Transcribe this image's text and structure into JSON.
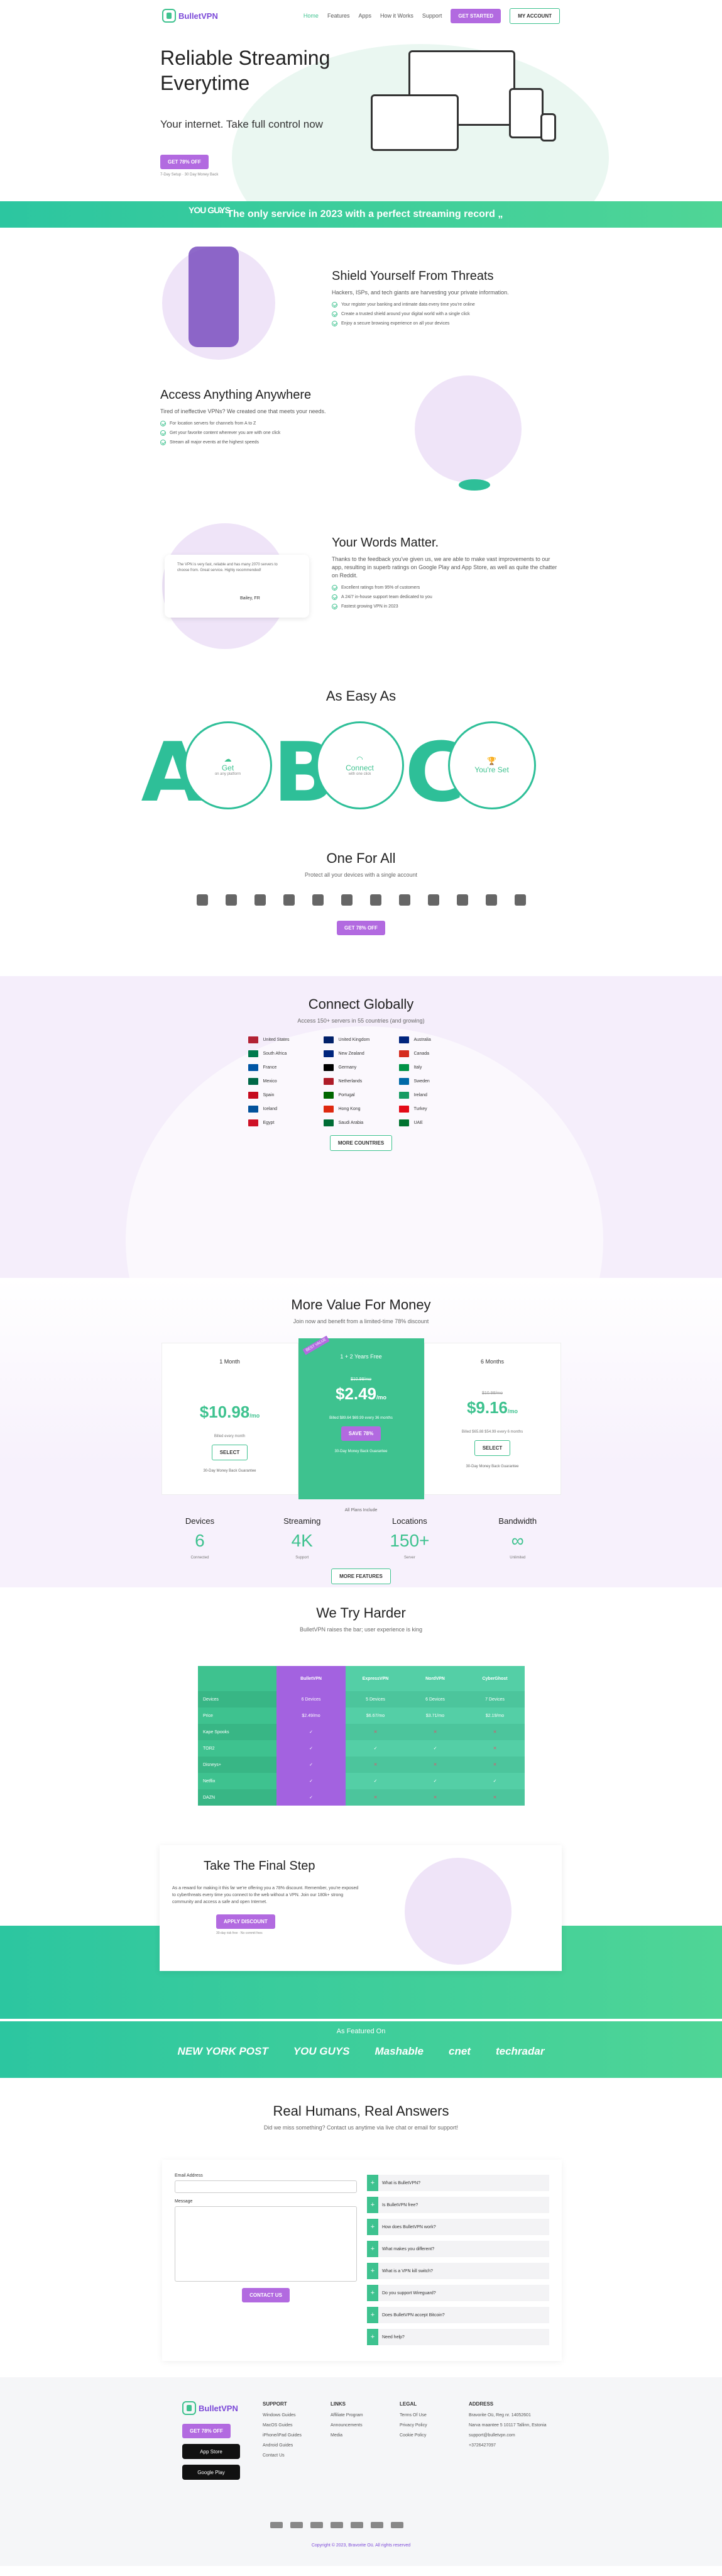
{
  "nav": {
    "brand": "BulletVPN",
    "items": [
      "Home",
      "Features",
      "Apps",
      "How it Works",
      "Support"
    ],
    "get_started": "GET STARTED",
    "account": "MY ACCOUNT"
  },
  "hero": {
    "title": "Reliable Streaming Everytime",
    "subtitle": "Your internet. Take full control now",
    "cta": "GET 78% OFF",
    "note": "7-Day Setup · 30 Day Money Back"
  },
  "strip": {
    "badge": "YOU GUYS",
    "text": "“ The only service in 2023 with a perfect streaming record „"
  },
  "shield": {
    "title": "Shield Yourself From Threats",
    "text": "Hackers, ISPs, and tech giants are harvesting your private information.",
    "items": [
      "Your register your banking and intimate data every time you're online",
      "Create a trusted shield around your digital world with a single click",
      "Enjoy a secure browsing experience on all your devices"
    ]
  },
  "access": {
    "title": "Access Anything Anywhere",
    "text": "Tired of ineffective VPNs? We created one that meets your needs.",
    "items": [
      "For location servers for channels from A to Z",
      "Get your favorite content wherever you are with one click",
      "Stream all major events at the highest speeds"
    ]
  },
  "words": {
    "title": "Your Words Matter.",
    "text": "Thanks to the feedback you've given us, we are able to make vast improvements to our app, resulting in superb ratings on Google Play and App Store, as well as quite the chatter on Reddit.",
    "items": [
      "Excellent ratings from 95% of customers",
      "A 24/7 in-house support team dedicated to you",
      "Fastest growing VPN in 2023"
    ],
    "quote": "The VPN is very fast, reliable and has many 2070 servers to choose from. Great service. Highly recommended!",
    "reviewer": "Bailey, FR"
  },
  "easy": {
    "title": "As Easy As",
    "steps": [
      {
        "letter": "A",
        "label": "Get",
        "sub": "on any platform"
      },
      {
        "letter": "B",
        "label": "Connect",
        "sub": "with one click"
      },
      {
        "letter": "C",
        "label": "You're Set",
        "sub": ""
      }
    ]
  },
  "oneforall": {
    "title": "One For All",
    "sub": "Protect all your devices with a single account",
    "cta": "GET 78% OFF"
  },
  "connect": {
    "title": "Connect Globally",
    "sub": "Access 150+ servers in 55 countries (and growing)",
    "countries": [
      "United States",
      "United Kingdom",
      "Australia",
      "South Africa",
      "New Zealand",
      "Canada",
      "France",
      "Germany",
      "Italy",
      "Mexico",
      "Netherlands",
      "Sweden",
      "Spain",
      "Portugal",
      "Ireland",
      "Iceland",
      "Hong Kong",
      "Turkey",
      "Egypt",
      "Saudi Arabia",
      "UAE"
    ],
    "more": "MORE COUNTRIES"
  },
  "pricing": {
    "title": "More Value For Money",
    "sub": "Join now and benefit from a limited-time 78% discount",
    "plans": [
      {
        "name": "1 Month",
        "price": "$10.98",
        "per": "/mo",
        "bill": "Billed every month",
        "select": "SELECT",
        "guar": "30-Day Money Back Guarantee"
      },
      {
        "name": "1 + 2 Years Free",
        "tag": "BEST VALUE",
        "old": "$10.98/mo",
        "price": "$2.49",
        "per": "/mo",
        "bill": "Billed $89.64 $69.99 every 36 months",
        "select": "SAVE 78%",
        "guar": "30-Day Money Back Guarantee"
      },
      {
        "name": "6 Months",
        "old": "$10.98/mo",
        "price": "$9.16",
        "per": "/mo",
        "bill": "Billed $65.88 $54.99 every 6 months",
        "select": "SELECT",
        "guar": "30-Day Money Back Guarantee"
      }
    ],
    "include": "All Plans Include",
    "stats": [
      {
        "label": "Devices",
        "value": "6",
        "sub": "Connected"
      },
      {
        "label": "Streaming",
        "value": "4K",
        "sub": "Support"
      },
      {
        "label": "Locations",
        "value": "150+",
        "sub": "Server"
      },
      {
        "label": "Bandwidth",
        "value": "∞",
        "sub": "Unlimited"
      }
    ],
    "more": "MORE FEATURES"
  },
  "harder": {
    "title": "We Try Harder",
    "sub": "BulletVPN raises the bar; user experience is king",
    "headers": [
      "",
      "BulletVPN",
      "ExpressVPN",
      "NordVPN",
      "CyberGhost"
    ],
    "rows": [
      [
        "Devices",
        "6 Devices",
        "5 Devices",
        "6 Devices",
        "7 Devices"
      ],
      [
        "Price",
        "$2.49/mo",
        "$6.67/mo",
        "$3.71/mo",
        "$2.19/mo"
      ],
      [
        "Kape Spooks",
        "✓",
        "✕",
        "✕",
        "✕"
      ],
      [
        "TOR2",
        "✓",
        "✓",
        "✓",
        "✕"
      ],
      [
        "Disneys+",
        "✓",
        "✕",
        "✕",
        "✕"
      ],
      [
        "Netflix",
        "✓",
        "✓",
        "✓",
        "✓"
      ],
      [
        "DAZN",
        "✓",
        "✕",
        "✕",
        "✕"
      ]
    ]
  },
  "final": {
    "title": "Take The Final Step",
    "text": "As a reward for making it this far we're offering you a 78% discount. Remember, you're exposed to cyberthreats every time you connect to the web without a VPN. Join our 180k+ strong community and access a safe and open Internet.",
    "cta": "APPLY DISCOUNT",
    "note": "30-day risk free · No commit fees"
  },
  "featured": {
    "title": "As Featured On",
    "logos": [
      "NEW YORK POST",
      "YOU GUYS",
      "Mashable",
      "cnet",
      "techradar"
    ]
  },
  "contact": {
    "title": "Real Humans, Real Answers",
    "sub": "Did we miss something? Contact us anytime via live chat or email for support!",
    "email_label": "Email Address",
    "message_label": "Message",
    "send": "CONTACT US",
    "faqs": [
      "What is BulletVPN?",
      "Is BulletVPN free?",
      "How does BulletVPN work?",
      "What makes you different?",
      "What is a VPN kill switch?",
      "Do you support Wireguard?",
      "Does BulletVPN accept Bitcoin?",
      "Need help?"
    ]
  },
  "footer": {
    "cta": "GET 78% OFF",
    "app_store": "App Store",
    "google_play": "Google Play",
    "support": {
      "title": "SUPPORT",
      "items": [
        "Windows Guides",
        "MacOS Guides",
        "iPhone/iPad Guides",
        "Android Guides",
        "Contact Us"
      ]
    },
    "links": {
      "title": "LINKS",
      "items": [
        "Affiliate Program",
        "Announcements",
        "Media"
      ]
    },
    "legal": {
      "title": "LEGAL",
      "items": [
        "Terms Of Use",
        "Privacy Policy",
        "Cookie Policy"
      ]
    },
    "address": {
      "title": "ADDRESS",
      "items": [
        "Bravorite Oü, Reg nr. 14052601",
        "Narva maantee 5 10117 Tallinn, Estonia",
        "support@bulletvpn.com",
        "+3726427097"
      ]
    },
    "copyright": "Copyright © 2023, Bravorite Oü. All rights reserved"
  },
  "colors": {
    "accent": "#b26ae0",
    "green": "#3ec28f"
  }
}
